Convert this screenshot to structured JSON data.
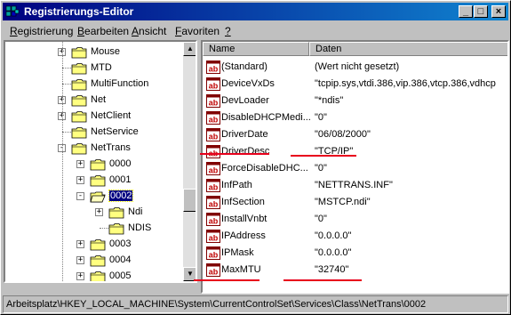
{
  "window": {
    "title": "Registrierungs-Editor",
    "buttons": {
      "minimize": "_",
      "maximize": "□",
      "close": "×"
    }
  },
  "menu": [
    {
      "label": "Registrierung",
      "underline": "R",
      "rest": "egistrierung"
    },
    {
      "label": "Bearbeiten",
      "underline": "B",
      "rest": "earbeiten"
    },
    {
      "label": "Ansicht",
      "underline": "A",
      "rest": "nsicht"
    },
    {
      "label": "Favoriten",
      "underline": "F",
      "rest": "avoriten"
    },
    {
      "label": "?",
      "underline": "?",
      "rest": ""
    }
  ],
  "tree": {
    "items": [
      {
        "label": "Mouse",
        "expander": "+"
      },
      {
        "label": "MTD",
        "expander": ""
      },
      {
        "label": "MultiFunction",
        "expander": ""
      },
      {
        "label": "Net",
        "expander": "+"
      },
      {
        "label": "NetClient",
        "expander": "+"
      },
      {
        "label": "NetService",
        "expander": ""
      },
      {
        "label": "NetTrans",
        "expander": "−"
      },
      {
        "label": "0000",
        "expander": "+"
      },
      {
        "label": "0001",
        "expander": "+"
      },
      {
        "label": "0002",
        "expander": "−",
        "selected": true
      },
      {
        "label": "Ndi",
        "expander": "+"
      },
      {
        "label": "NDIS",
        "expander": ""
      },
      {
        "label": "0003",
        "expander": "+"
      },
      {
        "label": "0004",
        "expander": "+"
      },
      {
        "label": "0005",
        "expander": "+"
      }
    ]
  },
  "values": {
    "headers": {
      "name": "Name",
      "data": "Daten"
    },
    "rows": [
      {
        "name": "(Standard)",
        "data": "(Wert nicht gesetzt)"
      },
      {
        "name": "DeviceVxDs",
        "data": "\"tcpip.sys,vtdi.386,vip.386,vtcp.386,vdhcp"
      },
      {
        "name": "DevLoader",
        "data": "\"*ndis\""
      },
      {
        "name": "DisableDHCPMedi...",
        "data": "\"0\""
      },
      {
        "name": "DriverDate",
        "data": "\"06/08/2000\""
      },
      {
        "name": "DriverDesc",
        "data": "\"TCP/IP\""
      },
      {
        "name": "ForceDisableDHC...",
        "data": "\"0\""
      },
      {
        "name": "InfPath",
        "data": "\"NETTRANS.INF\""
      },
      {
        "name": "InfSection",
        "data": "\"MSTCP.ndi\""
      },
      {
        "name": "InstallVnbt",
        "data": "\"0\""
      },
      {
        "name": "IPAddress",
        "data": "\"0.0.0.0\""
      },
      {
        "name": "IPMask",
        "data": "\"0.0.0.0\""
      },
      {
        "name": "MaxMTU",
        "data": "\"32740\""
      }
    ]
  },
  "status": {
    "path": "Arbeitsplatz\\HKEY_LOCAL_MACHINE\\System\\CurrentControlSet\\Services\\Class\\NetTrans\\0002"
  },
  "colors": {
    "titlebar": "#000080",
    "selection": "#000080",
    "annotation": "#e8001c",
    "folder": "#ffff80"
  }
}
